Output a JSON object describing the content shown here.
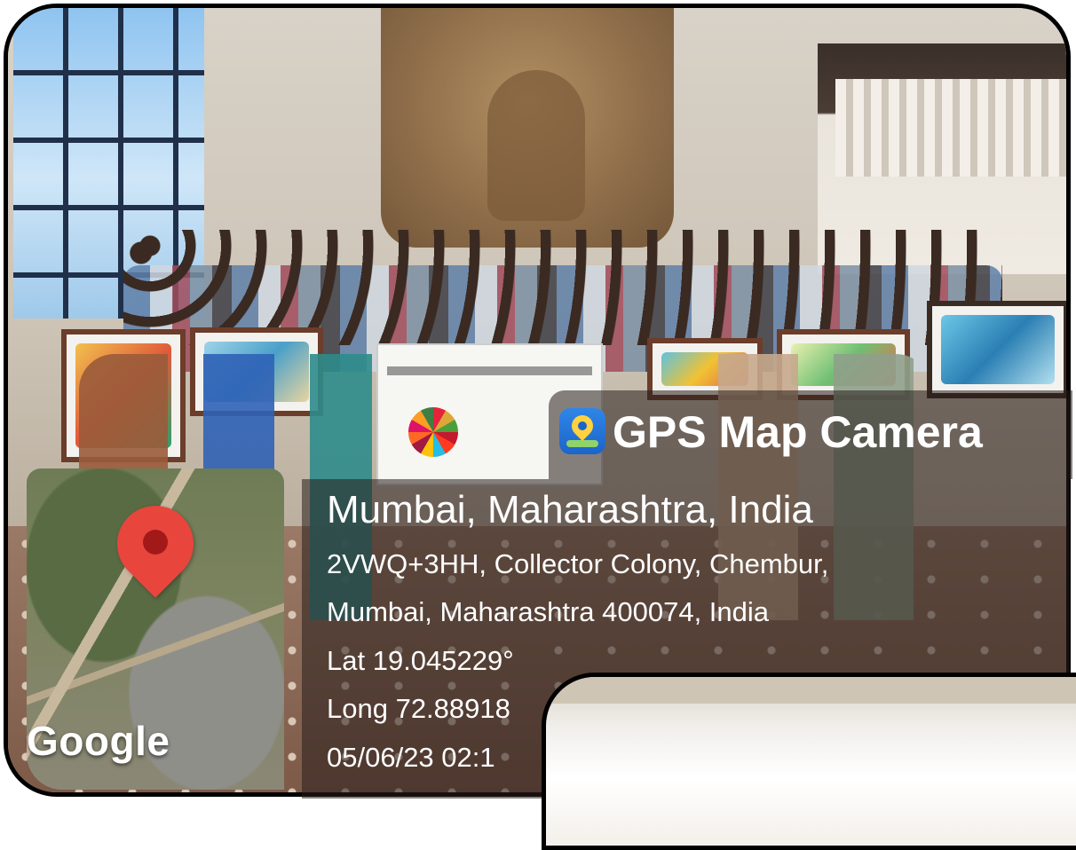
{
  "overlay": {
    "app_name": "GPS Map Camera",
    "location_title": "Mumbai, Maharashtra, India",
    "address_line1": "2VWQ+3HH, Collector Colony, Chembur,",
    "address_line2": "Mumbai, Maharashtra 400074, India",
    "latitude": "Lat 19.045229°",
    "longitude": "Long 72.88918",
    "datetime": "05/06/23 02:1"
  },
  "map": {
    "brand": "Google",
    "pin_color": "#e8453c"
  },
  "icons": {
    "app": "gps-map-camera-icon",
    "marker": "map-pin-icon"
  }
}
